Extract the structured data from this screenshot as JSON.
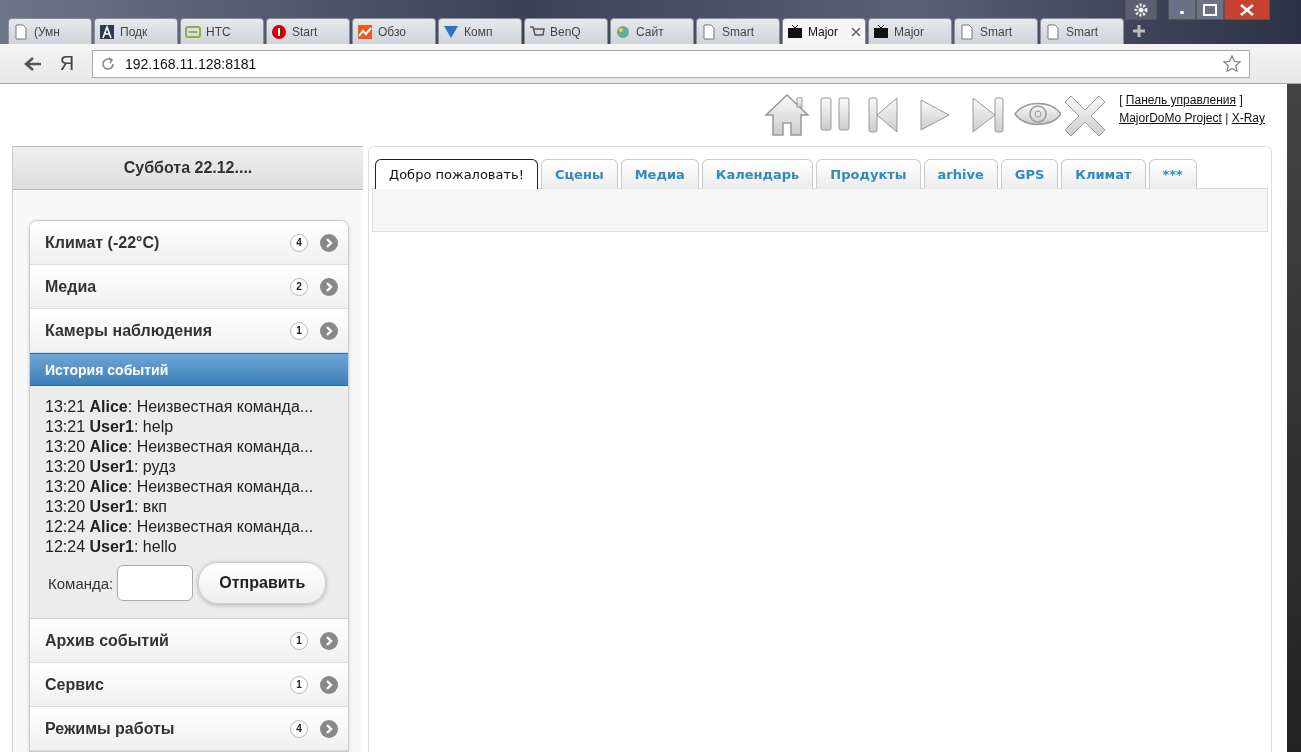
{
  "browser": {
    "tabs": [
      {
        "title": "(Умн",
        "selected": false
      },
      {
        "title": "Подк",
        "selected": false
      },
      {
        "title": "HTC",
        "selected": false
      },
      {
        "title": "Start",
        "selected": false
      },
      {
        "title": "Обзо",
        "selected": false
      },
      {
        "title": "Комп",
        "selected": false
      },
      {
        "title": "BenQ",
        "selected": false
      },
      {
        "title": "Сайт",
        "selected": false
      },
      {
        "title": "Smart",
        "selected": false
      },
      {
        "title": "Major",
        "selected": true
      },
      {
        "title": "Major",
        "selected": false
      },
      {
        "title": "Smart",
        "selected": false
      },
      {
        "title": "Smart",
        "selected": false
      }
    ],
    "home_button": "Я",
    "address": "192.168.11.128:8181"
  },
  "header": {
    "control_panel": {
      "open": "[",
      "link": "Панель управления",
      "close": "]"
    },
    "links": [
      "MajorDoMo Project",
      "X-Ray"
    ],
    "separator": "|"
  },
  "sidebar": {
    "date": "Суббота 22.12....",
    "menu_top": [
      {
        "label": "Климат (-22°C)",
        "count": "4"
      },
      {
        "label": "Медиа",
        "count": "2"
      },
      {
        "label": "Камеры наблюдения",
        "count": "1"
      }
    ],
    "history": {
      "title": "История событий",
      "entries": [
        "13:21 **Alice**: Неизвестная команда...",
        "13:21 **User1**: help",
        "13:20 **Alice**: Неизвестная команда...",
        "13:20 **User1**: рудз",
        "13:20 **Alice**: Неизвестная команда...",
        "13:20 **User1**: вкп",
        "12:24 **Alice**: Неизвестная команда...",
        "12:24 **User1**: hello"
      ],
      "command_label": "Команда:",
      "send_button": "Отправить"
    },
    "menu_bottom": [
      {
        "label": "Архив событий",
        "count": "1"
      },
      {
        "label": "Сервис",
        "count": "1"
      },
      {
        "label": "Режимы работы",
        "count": "4"
      }
    ]
  },
  "main": {
    "tabs": [
      {
        "label": "Добро пожаловать!",
        "selected": true
      },
      {
        "label": "Сцены",
        "selected": false
      },
      {
        "label": "Медиа",
        "selected": false
      },
      {
        "label": "Календарь",
        "selected": false
      },
      {
        "label": "Продукты",
        "selected": false
      },
      {
        "label": "arhive",
        "selected": false
      },
      {
        "label": "GPS",
        "selected": false
      },
      {
        "label": "Климат",
        "selected": false
      },
      {
        "label": "***",
        "selected": false
      }
    ]
  }
}
